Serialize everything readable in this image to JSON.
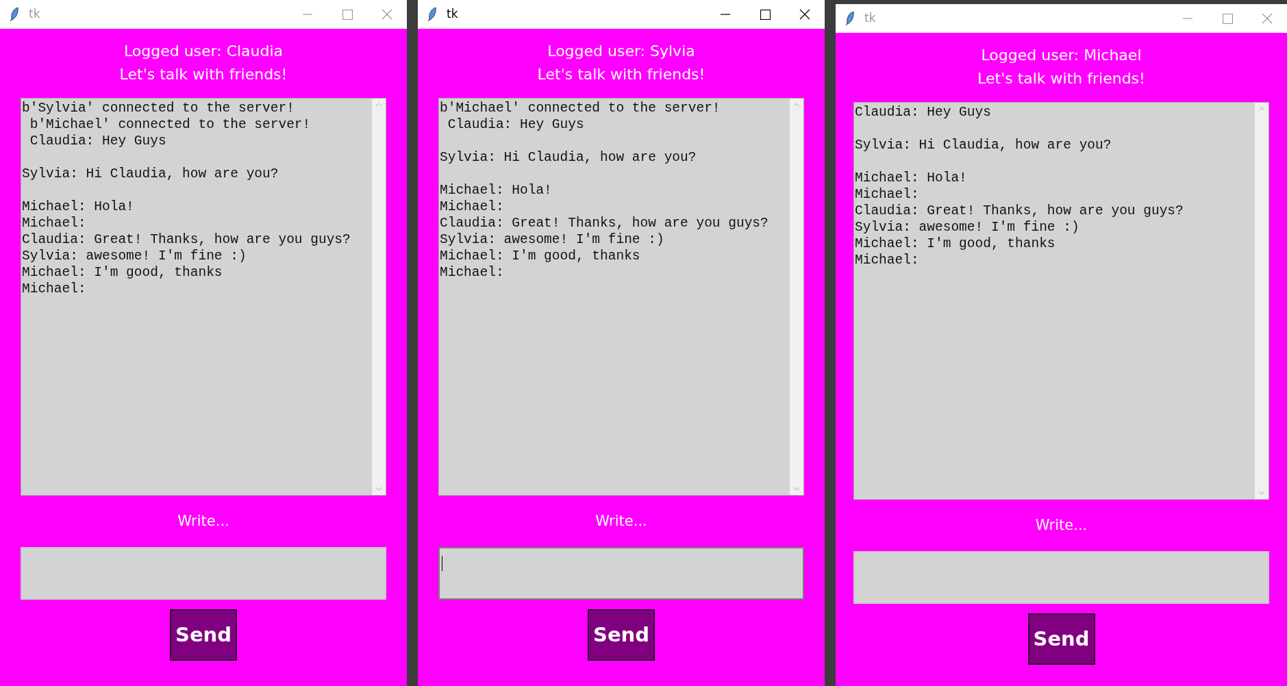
{
  "windows": [
    {
      "title": "tk",
      "active": false,
      "logged_user": "Logged user: Claudia",
      "subtitle": "Let's talk with friends!",
      "chat_log": "b'Sylvia' connected to the server!\n b'Michael' connected to the server!\n Claudia: Hey Guys\n\nSylvia: Hi Claudia, how are you?\n\nMichael: Hola!\nMichael:\nClaudia: Great! Thanks, how are you guys?\nSylvia: awesome! I'm fine :)\nMichael: I'm good, thanks\nMichael:",
      "write_label": "Write...",
      "input": {
        "focused": false
      },
      "send_button": "Send"
    },
    {
      "title": "tk",
      "active": true,
      "logged_user": "Logged user: Sylvia",
      "subtitle": "Let's talk with friends!",
      "chat_log": "b'Michael' connected to the server!\n Claudia: Hey Guys\n\nSylvia: Hi Claudia, how are you?\n\nMichael: Hola!\nMichael:\nClaudia: Great! Thanks, how are you guys?\nSylvia: awesome! I'm fine :)\nMichael: I'm good, thanks\nMichael:",
      "write_label": "Write...",
      "input": {
        "focused": true
      },
      "send_button": "Send"
    },
    {
      "title": "tk",
      "active": false,
      "logged_user": "Logged user: Michael",
      "subtitle": "Let's talk with friends!",
      "chat_log": "Claudia: Hey Guys\n\nSylvia: Hi Claudia, how are you?\n\nMichael: Hola!\nMichael:\nClaudia: Great! Thanks, how are you guys?\nSylvia: awesome! I'm fine :)\nMichael: I'm good, thanks\nMichael:",
      "write_label": "Write...",
      "input": {
        "focused": false
      },
      "send_button": "Send"
    }
  ]
}
